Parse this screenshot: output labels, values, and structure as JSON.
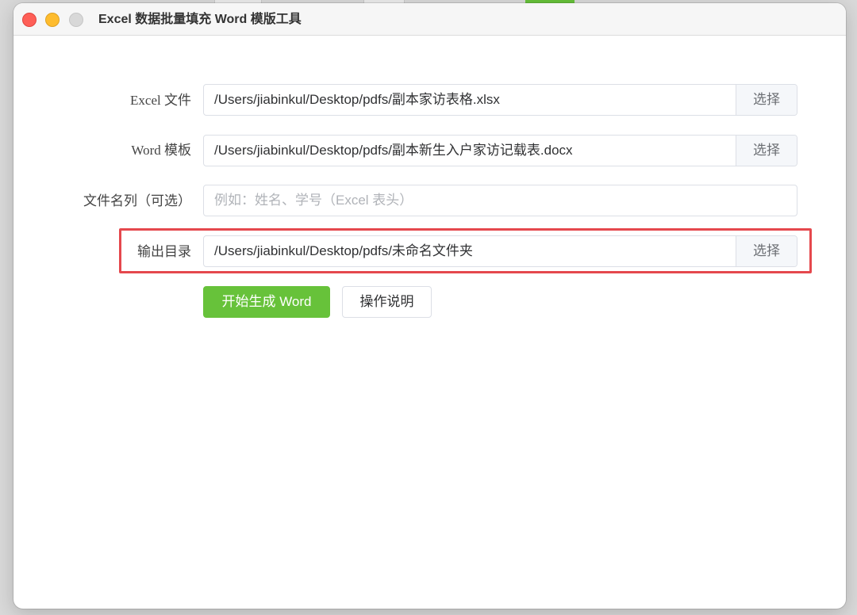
{
  "window": {
    "title": "Excel 数据批量填充 Word 模版工具"
  },
  "form": {
    "excel_file": {
      "label": "Excel 文件",
      "value": "/Users/jiabinkul/Desktop/pdfs/副本家访表格.xlsx",
      "button": "选择"
    },
    "word_template": {
      "label": "Word 模板",
      "value": "/Users/jiabinkul/Desktop/pdfs/副本新生入户家访记载表.docx",
      "button": "选择"
    },
    "file_name_column": {
      "label": "文件名列（可选）",
      "placeholder": "例如：姓名、学号（Excel 表头）"
    },
    "output_dir": {
      "label": "输出目录",
      "value": "/Users/jiabinkul/Desktop/pdfs/未命名文件夹",
      "button": "选择"
    }
  },
  "actions": {
    "generate": "开始生成 Word",
    "help": "操作说明"
  },
  "colors": {
    "primary": "#67c23a",
    "highlight": "#e5484d"
  }
}
